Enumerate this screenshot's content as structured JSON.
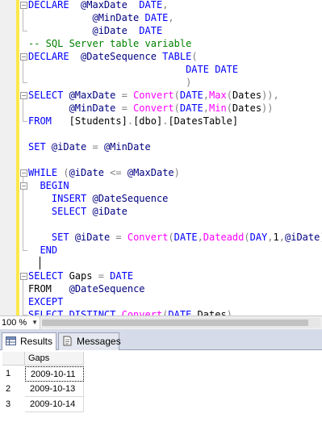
{
  "editor": {
    "lines": [
      [
        [
          "kw",
          "DECLARE"
        ],
        [
          "",
          "  "
        ],
        [
          "vr",
          "@MaxDate"
        ],
        [
          "",
          "  "
        ],
        [
          "kw",
          "DATE"
        ],
        [
          "op",
          ","
        ]
      ],
      [
        [
          "",
          "           "
        ],
        [
          "vr",
          "@MinDate"
        ],
        [
          "",
          ""
        ],
        [
          "kw",
          " DATE"
        ],
        [
          "op",
          ","
        ]
      ],
      [
        [
          "",
          "           "
        ],
        [
          "vr",
          "@iDate"
        ],
        [
          "",
          "  "
        ],
        [
          "kw",
          "DATE"
        ]
      ],
      [
        [
          "cm",
          "-- SQL Server table variable"
        ]
      ],
      [
        [
          "kw",
          "DECLARE"
        ],
        [
          "",
          "  "
        ],
        [
          "vr",
          "@DateSequence"
        ],
        [
          "",
          ""
        ],
        [
          "kw",
          " TABLE"
        ],
        [
          "op",
          "("
        ]
      ],
      [
        [
          "",
          "                           "
        ],
        [
          "kw",
          "DATE DATE"
        ]
      ],
      [
        [
          "",
          "                           "
        ],
        [
          "op",
          ")"
        ]
      ],
      [
        [
          "kw",
          "SELECT"
        ],
        [
          "",
          ""
        ],
        [
          "vr",
          " @MaxDate"
        ],
        [
          "op",
          " ="
        ],
        [
          "fn",
          " Convert"
        ],
        [
          "op",
          "("
        ],
        [
          "kw",
          "DATE"
        ],
        [
          "op",
          ","
        ],
        [
          "fn",
          "Max"
        ],
        [
          "op",
          "("
        ],
        [
          "",
          "Dates"
        ],
        [
          "op",
          "))"
        ],
        [
          "op",
          ","
        ]
      ],
      [
        [
          "",
          "       "
        ],
        [
          "vr",
          "@MinDate"
        ],
        [
          "op",
          " ="
        ],
        [
          "fn",
          " Convert"
        ],
        [
          "op",
          "("
        ],
        [
          "kw",
          "DATE"
        ],
        [
          "op",
          ","
        ],
        [
          "fn",
          "Min"
        ],
        [
          "op",
          "("
        ],
        [
          "",
          "Dates"
        ],
        [
          "op",
          "))"
        ]
      ],
      [
        [
          "kw",
          "FROM"
        ],
        [
          "",
          "   "
        ],
        [
          "",
          "[Students]"
        ],
        [
          "op",
          "."
        ],
        [
          "",
          "[dbo]"
        ],
        [
          "op",
          "."
        ],
        [
          "",
          "[DatesTable]"
        ]
      ],
      [],
      [
        [
          "kw",
          "SET"
        ],
        [
          "",
          ""
        ],
        [
          "vr",
          " @iDate"
        ],
        [
          "op",
          " ="
        ],
        [
          "vr",
          " @MinDate"
        ]
      ],
      [],
      [
        [
          "kw",
          "WHILE"
        ],
        [
          "",
          ""
        ],
        [
          "op",
          " ("
        ],
        [
          "vr",
          "@iDate"
        ],
        [
          "op",
          " <="
        ],
        [
          "vr",
          " @MaxDate"
        ],
        [
          "op",
          ")"
        ]
      ],
      [
        [
          "",
          "  "
        ],
        [
          "kw",
          "BEGIN"
        ]
      ],
      [
        [
          "",
          "    "
        ],
        [
          "kw",
          "INSERT"
        ],
        [
          "",
          ""
        ],
        [
          "vr",
          " @DateSequence"
        ]
      ],
      [
        [
          "",
          "    "
        ],
        [
          "kw",
          "SELECT"
        ],
        [
          "",
          ""
        ],
        [
          "vr",
          " @iDate"
        ]
      ],
      [],
      [
        [
          "",
          "    "
        ],
        [
          "kw",
          "SET"
        ],
        [
          "",
          ""
        ],
        [
          "vr",
          " @iDate"
        ],
        [
          "op",
          " ="
        ],
        [
          "fn",
          " Convert"
        ],
        [
          "op",
          "("
        ],
        [
          "kw",
          "DATE"
        ],
        [
          "op",
          ","
        ],
        [
          "fn",
          "Dateadd"
        ],
        [
          "op",
          "("
        ],
        [
          "kw",
          "DAY"
        ],
        [
          "op",
          ","
        ],
        [
          "",
          "1"
        ],
        [
          "op",
          ","
        ],
        [
          "vr",
          "@iDate"
        ],
        [
          "op",
          "))"
        ]
      ],
      [
        [
          "",
          "  "
        ],
        [
          "kw",
          "END"
        ]
      ],
      [],
      [
        [
          "kw",
          "SELECT"
        ],
        [
          "",
          ""
        ],
        [
          "",
          ""
        ],
        [
          "kw",
          ""
        ],
        [
          "",
          ""
        ],
        [
          "",
          ""
        ],
        [
          "",
          ""
        ],
        [
          "",
          ""
        ],
        [
          "",
          ""
        ],
        [
          "",
          ""
        ],
        [
          "",
          ""
        ],
        [
          "",
          ""
        ],
        [
          "",
          ""
        ],
        [
          "",
          ""
        ],
        [
          "",
          ""
        ],
        [
          "",
          ""
        ]
      ],
      [
        [
          "",
          "FROM"
        ],
        [
          "",
          "   "
        ],
        [
          "vr",
          "@DateSequence"
        ]
      ],
      [
        [
          "kw",
          "EXCEPT"
        ]
      ],
      [
        [
          "kw",
          "SELECT DISTINCT"
        ],
        [
          "fn",
          " Convert"
        ],
        [
          "op",
          "("
        ],
        [
          "kw",
          "DATE"
        ],
        [
          "op",
          ","
        ],
        [
          "",
          "Dates"
        ],
        [
          "op",
          ")"
        ]
      ]
    ],
    "select_gaps_line": [
      [
        "kw",
        "SELECT"
      ],
      [
        "",
        " Gaps "
      ],
      [
        "op",
        "="
      ],
      [
        "kw",
        " DATE"
      ]
    ]
  },
  "zoom": {
    "value": "100 %"
  },
  "tabs": {
    "results": "Results",
    "messages": "Messages"
  },
  "grid": {
    "column": "Gaps",
    "rows": [
      {
        "num": "1",
        "value": "2009-10-11"
      },
      {
        "num": "2",
        "value": "2009-10-13"
      },
      {
        "num": "3",
        "value": "2009-10-14"
      }
    ]
  },
  "colors": {
    "keyword": "#0000ff",
    "function": "#ff00ff",
    "variable": "#000080",
    "operator": "#808080",
    "comment": "#008000",
    "change_bar": "#fde84b"
  }
}
